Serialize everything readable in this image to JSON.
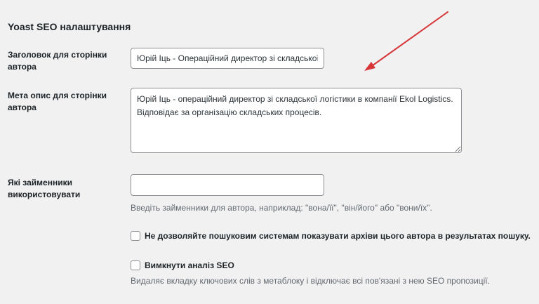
{
  "section": {
    "title": "Yoast SEO налаштування"
  },
  "author_title": {
    "label": "Заголовок для сторінки автора",
    "value": "Юрій Іць - Операційний директор зі складської ло"
  },
  "author_meta": {
    "label": "Мета опис для сторінки автора",
    "value": "Юрій Іць - операційний директор зі складської логістики в компанії Ekol Logistics. Відповідає за організацію складських процесів."
  },
  "pronouns": {
    "label": "Які займенники використовувати",
    "value": "",
    "description": "Введіть займенники для автора, наприклад: \"вона/її\", \"він/його\" або \"вони/їх\"."
  },
  "noindex": {
    "label": "Не дозволяйте пошуковим системам показувати архіви цього автора в результатах пошуку.",
    "checked": false
  },
  "disable_seo": {
    "label": "Вимкнути аналіз SEO",
    "checked": false,
    "description": "Видаляє вкладку ключових слів з метаблоку і відключає всі пов'язані з нею SEO пропозиції."
  },
  "annotation": {
    "arrow_color": "#d63638"
  }
}
